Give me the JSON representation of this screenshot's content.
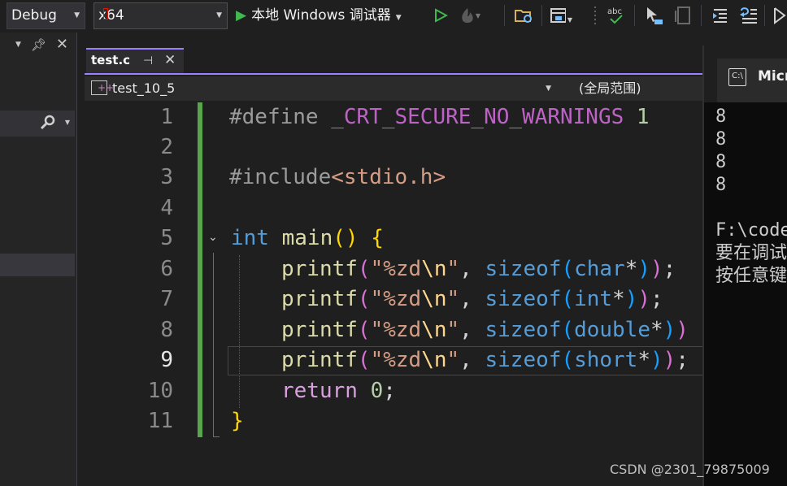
{
  "toolbar": {
    "config": "Debug",
    "platform": "x64",
    "run_label": "本地 Windows 调试器",
    "colors": {
      "run": "#3fb950",
      "highlight": "#e51400"
    }
  },
  "left_panel": {
    "icons": [
      "chevron-down-icon",
      "pin-icon",
      "close-icon",
      "search-icon"
    ]
  },
  "editor": {
    "tab_title": "test.c",
    "scope": "test_10_5",
    "global_scope": "(全局范围)",
    "accent": "#9b80ff",
    "line_numbers": [
      "1",
      "2",
      "3",
      "4",
      "5",
      "6",
      "7",
      "8",
      "9",
      "10",
      "11"
    ],
    "current_line": "9",
    "code": {
      "l1_a": "#define ",
      "l1_b": "_CRT_SECURE_NO_WARNINGS",
      "l1_c": " 1",
      "l3_a": "#include",
      "l3_b": "<stdio.h>",
      "l5_a": "int",
      "l5_b": " main",
      "l5_c": "()",
      "l5_d": " {",
      "printf": "printf",
      "open": "(",
      "str_open": "\"%zd",
      "esc": "\\n",
      "str_close": "\"",
      "comma": ", ",
      "sizeof": "sizeof",
      "t6": "char",
      "t7": "int",
      "t8": "double",
      "t9": "short",
      "star": "*",
      "close_in": ")",
      "close_out": ")",
      "semi": ";",
      "ret": "return",
      "zero": " 0",
      "brace_close": "}"
    }
  },
  "console": {
    "title": "Micr",
    "output": [
      "8",
      "8",
      "8",
      "8",
      "",
      "F:\\code",
      "要在调试",
      "按任意键"
    ]
  },
  "watermark": "CSDN @2301_79875009"
}
